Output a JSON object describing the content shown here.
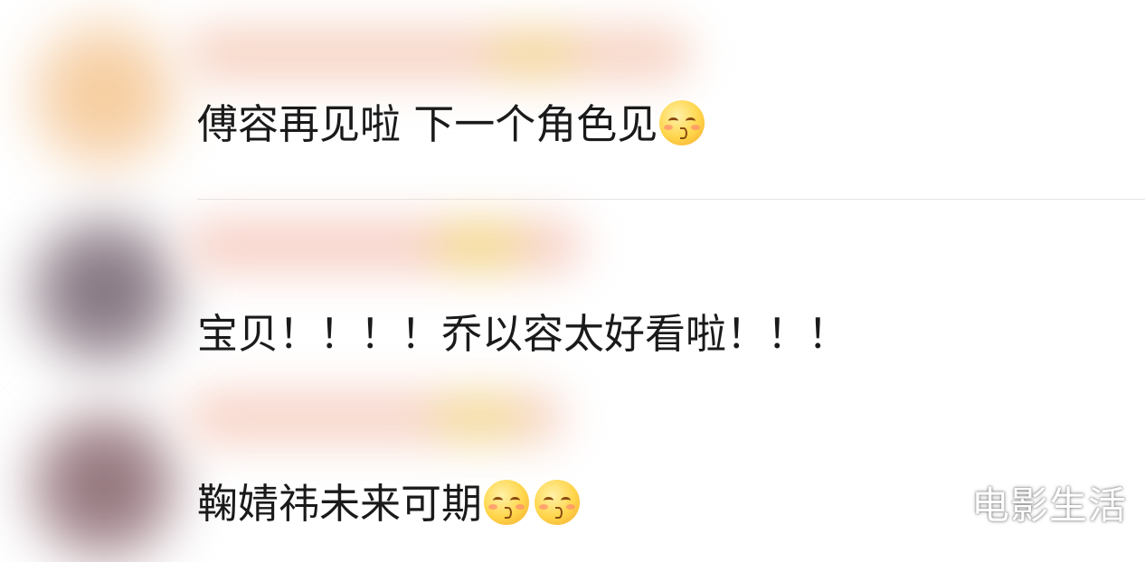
{
  "comments": [
    {
      "text": "傅容再见啦 下一个角色见",
      "emojis": [
        "kissing-smiling-eyes-icon"
      ]
    },
    {
      "text": "宝贝！！！！乔以容太好看啦！！！",
      "emojis": []
    },
    {
      "text": "鞠婧祎未来可期",
      "emojis": [
        "kissing-smiling-eyes-icon",
        "kissing-smiling-eyes-icon"
      ]
    }
  ],
  "watermark": "电影生活",
  "colors": {
    "text": "#1a1a1a",
    "divider": "#e5e5e5",
    "avatar_1": "#f2c89a",
    "avatar_2": "#7d6f7a",
    "avatar_3": "#8a6f74",
    "name_blur": "#f6c9b5",
    "name_blur_dot": "#f6d98a"
  }
}
